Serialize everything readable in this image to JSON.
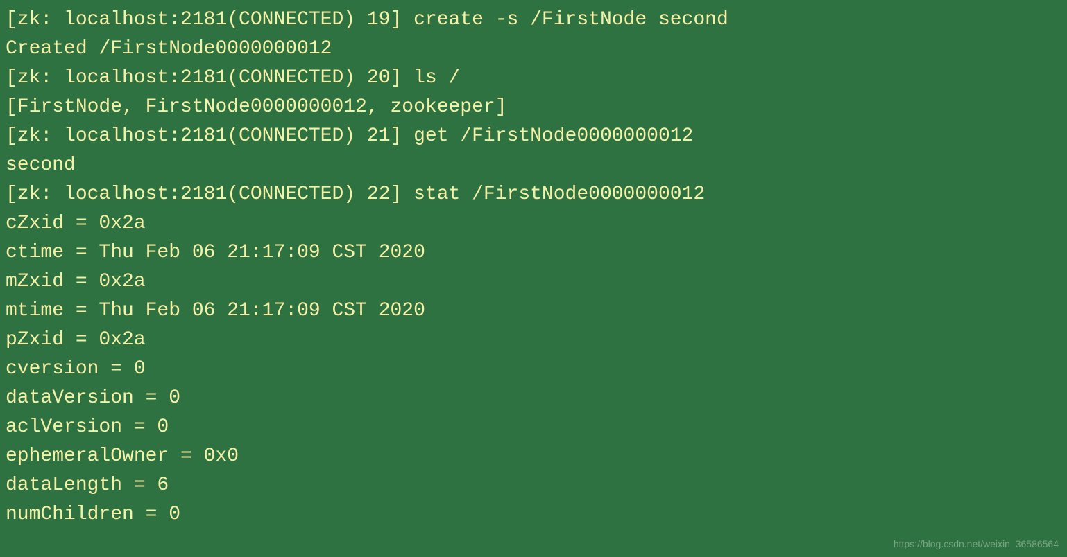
{
  "terminal": {
    "lines": [
      "[zk: localhost:2181(CONNECTED) 19] create -s /FirstNode second",
      "Created /FirstNode0000000012",
      "[zk: localhost:2181(CONNECTED) 20] ls /",
      "[FirstNode, FirstNode0000000012, zookeeper]",
      "[zk: localhost:2181(CONNECTED) 21] get /FirstNode0000000012",
      "second",
      "[zk: localhost:2181(CONNECTED) 22] stat /FirstNode0000000012",
      "cZxid = 0x2a",
      "ctime = Thu Feb 06 21:17:09 CST 2020",
      "mZxid = 0x2a",
      "mtime = Thu Feb 06 21:17:09 CST 2020",
      "pZxid = 0x2a",
      "cversion = 0",
      "dataVersion = 0",
      "aclVersion = 0",
      "ephemeralOwner = 0x0",
      "dataLength = 6",
      "numChildren = 0"
    ]
  },
  "watermark": "https://blog.csdn.net/weixin_36586564"
}
